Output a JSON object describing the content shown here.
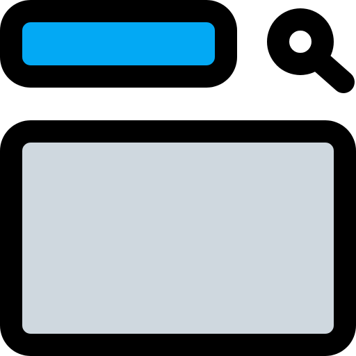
{
  "icon": {
    "name": "search-window-icon"
  },
  "colors": {
    "background": "#ffffff",
    "stroke": "#000000",
    "search_bar_fill": "#03a9f4",
    "content_fill": "#cfd8df",
    "search_lens_fill": "#ffffff"
  },
  "search_bar": {
    "text": ""
  },
  "content": {
    "text": ""
  }
}
